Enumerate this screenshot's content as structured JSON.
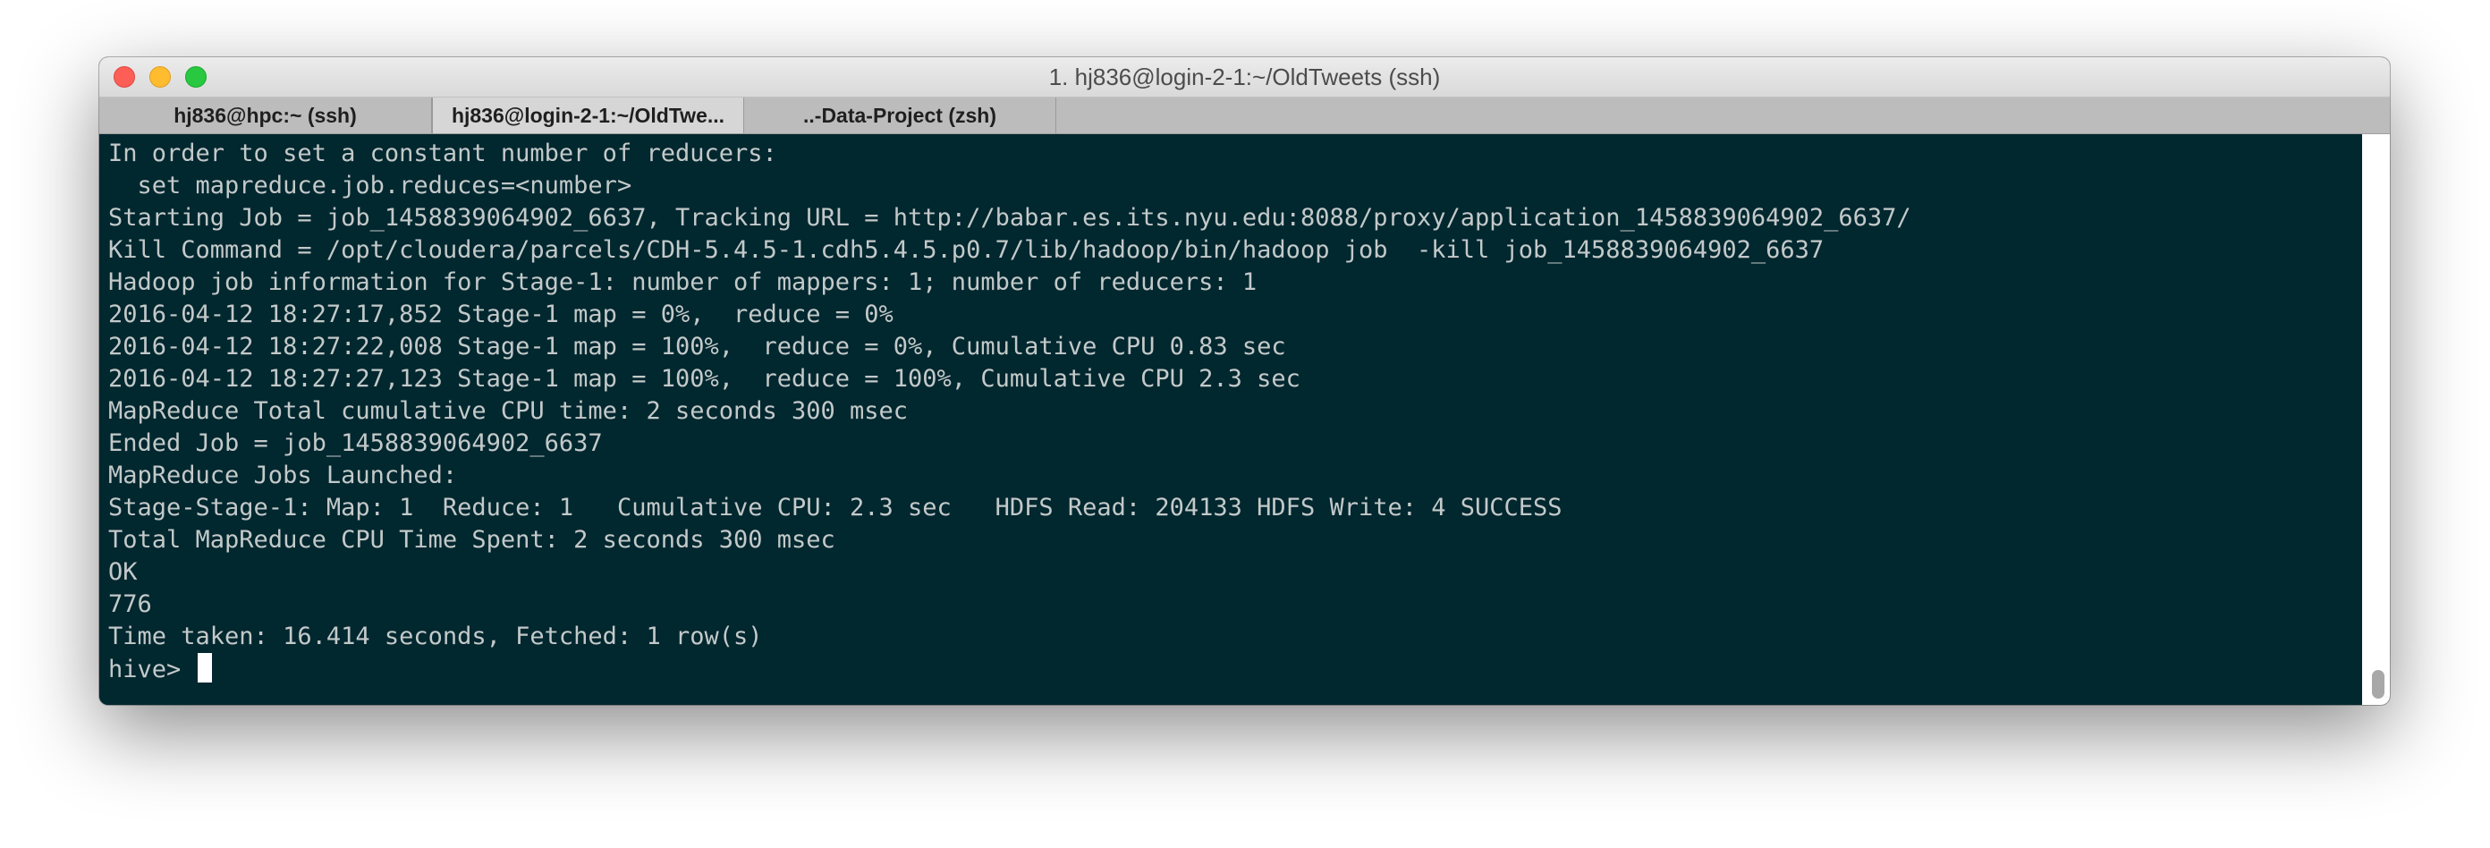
{
  "window": {
    "title": "1. hj836@login-2-1:~/OldTweets (ssh)"
  },
  "tabs": [
    {
      "label": "hj836@hpc:~ (ssh)"
    },
    {
      "label": "hj836@login-2-1:~/OldTwe..."
    },
    {
      "label": "..-Data-Project (zsh)"
    }
  ],
  "terminal": {
    "lines": [
      "In order to set a constant number of reducers:",
      "  set mapreduce.job.reduces=<number>",
      "Starting Job = job_1458839064902_6637, Tracking URL = http://babar.es.its.nyu.edu:8088/proxy/application_1458839064902_6637/",
      "Kill Command = /opt/cloudera/parcels/CDH-5.4.5-1.cdh5.4.5.p0.7/lib/hadoop/bin/hadoop job  -kill job_1458839064902_6637",
      "Hadoop job information for Stage-1: number of mappers: 1; number of reducers: 1",
      "2016-04-12 18:27:17,852 Stage-1 map = 0%,  reduce = 0%",
      "2016-04-12 18:27:22,008 Stage-1 map = 100%,  reduce = 0%, Cumulative CPU 0.83 sec",
      "2016-04-12 18:27:27,123 Stage-1 map = 100%,  reduce = 100%, Cumulative CPU 2.3 sec",
      "MapReduce Total cumulative CPU time: 2 seconds 300 msec",
      "Ended Job = job_1458839064902_6637",
      "MapReduce Jobs Launched:",
      "Stage-Stage-1: Map: 1  Reduce: 1   Cumulative CPU: 2.3 sec   HDFS Read: 204133 HDFS Write: 4 SUCCESS",
      "Total MapReduce CPU Time Spent: 2 seconds 300 msec",
      "OK",
      "776",
      "Time taken: 16.414 seconds, Fetched: 1 row(s)"
    ],
    "prompt": "hive> "
  },
  "colors": {
    "terminal_background": "#01272f",
    "terminal_foreground": "#c3c9c9"
  }
}
